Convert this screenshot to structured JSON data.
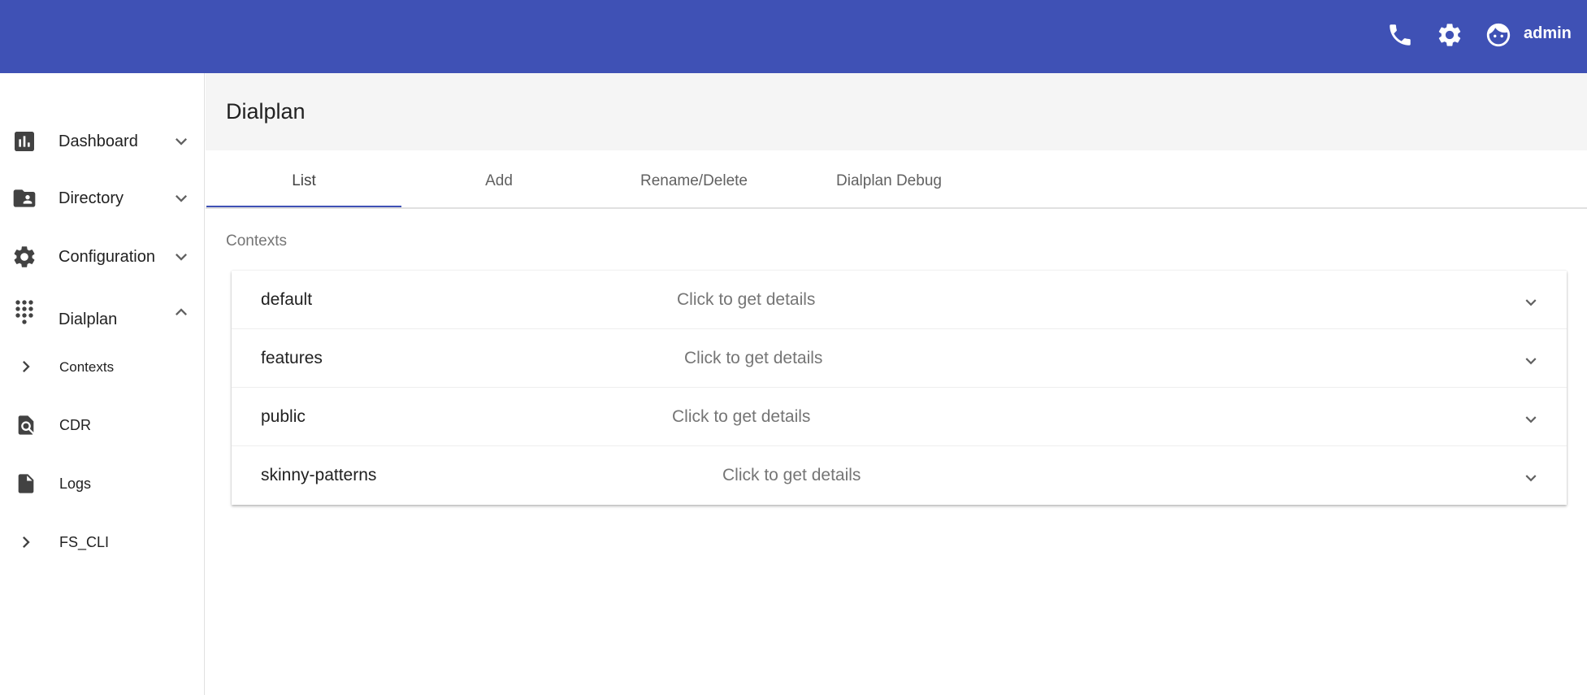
{
  "header": {
    "user_name": "admin",
    "accent_color": "#3f51b5",
    "icons": [
      "phone-icon",
      "gear-icon",
      "user-face-icon"
    ]
  },
  "sidebar": {
    "items": [
      {
        "label": "Dashboard",
        "icon": "bar-chart-icon",
        "chevron": "down"
      },
      {
        "label": "Directory",
        "icon": "folder-user-icon",
        "chevron": "down"
      },
      {
        "label": "Configuration",
        "icon": "gear-icon",
        "chevron": "down"
      },
      {
        "label": "Dialplan",
        "icon": "dialpad-icon",
        "chevron": "up"
      }
    ],
    "subitems": [
      {
        "label": "Contexts",
        "icon": "chevron-right-icon"
      },
      {
        "label": "CDR",
        "icon": "document-search-icon"
      },
      {
        "label": "Logs",
        "icon": "file-icon"
      },
      {
        "label": "FS_CLI",
        "icon": "chevron-right-icon"
      }
    ]
  },
  "main": {
    "title": "Dialplan",
    "tabs": [
      {
        "label": "List",
        "active": true
      },
      {
        "label": "Add",
        "active": false
      },
      {
        "label": "Rename/Delete",
        "active": false
      },
      {
        "label": "Dialplan Debug",
        "active": false
      }
    ],
    "section_label": "Contexts",
    "contexts": [
      {
        "name": "default",
        "hint": "Click to get details"
      },
      {
        "name": "features",
        "hint": "Click to get details"
      },
      {
        "name": "public",
        "hint": "Click to get details"
      },
      {
        "name": "skinny-patterns",
        "hint": "Click to get details"
      }
    ]
  }
}
